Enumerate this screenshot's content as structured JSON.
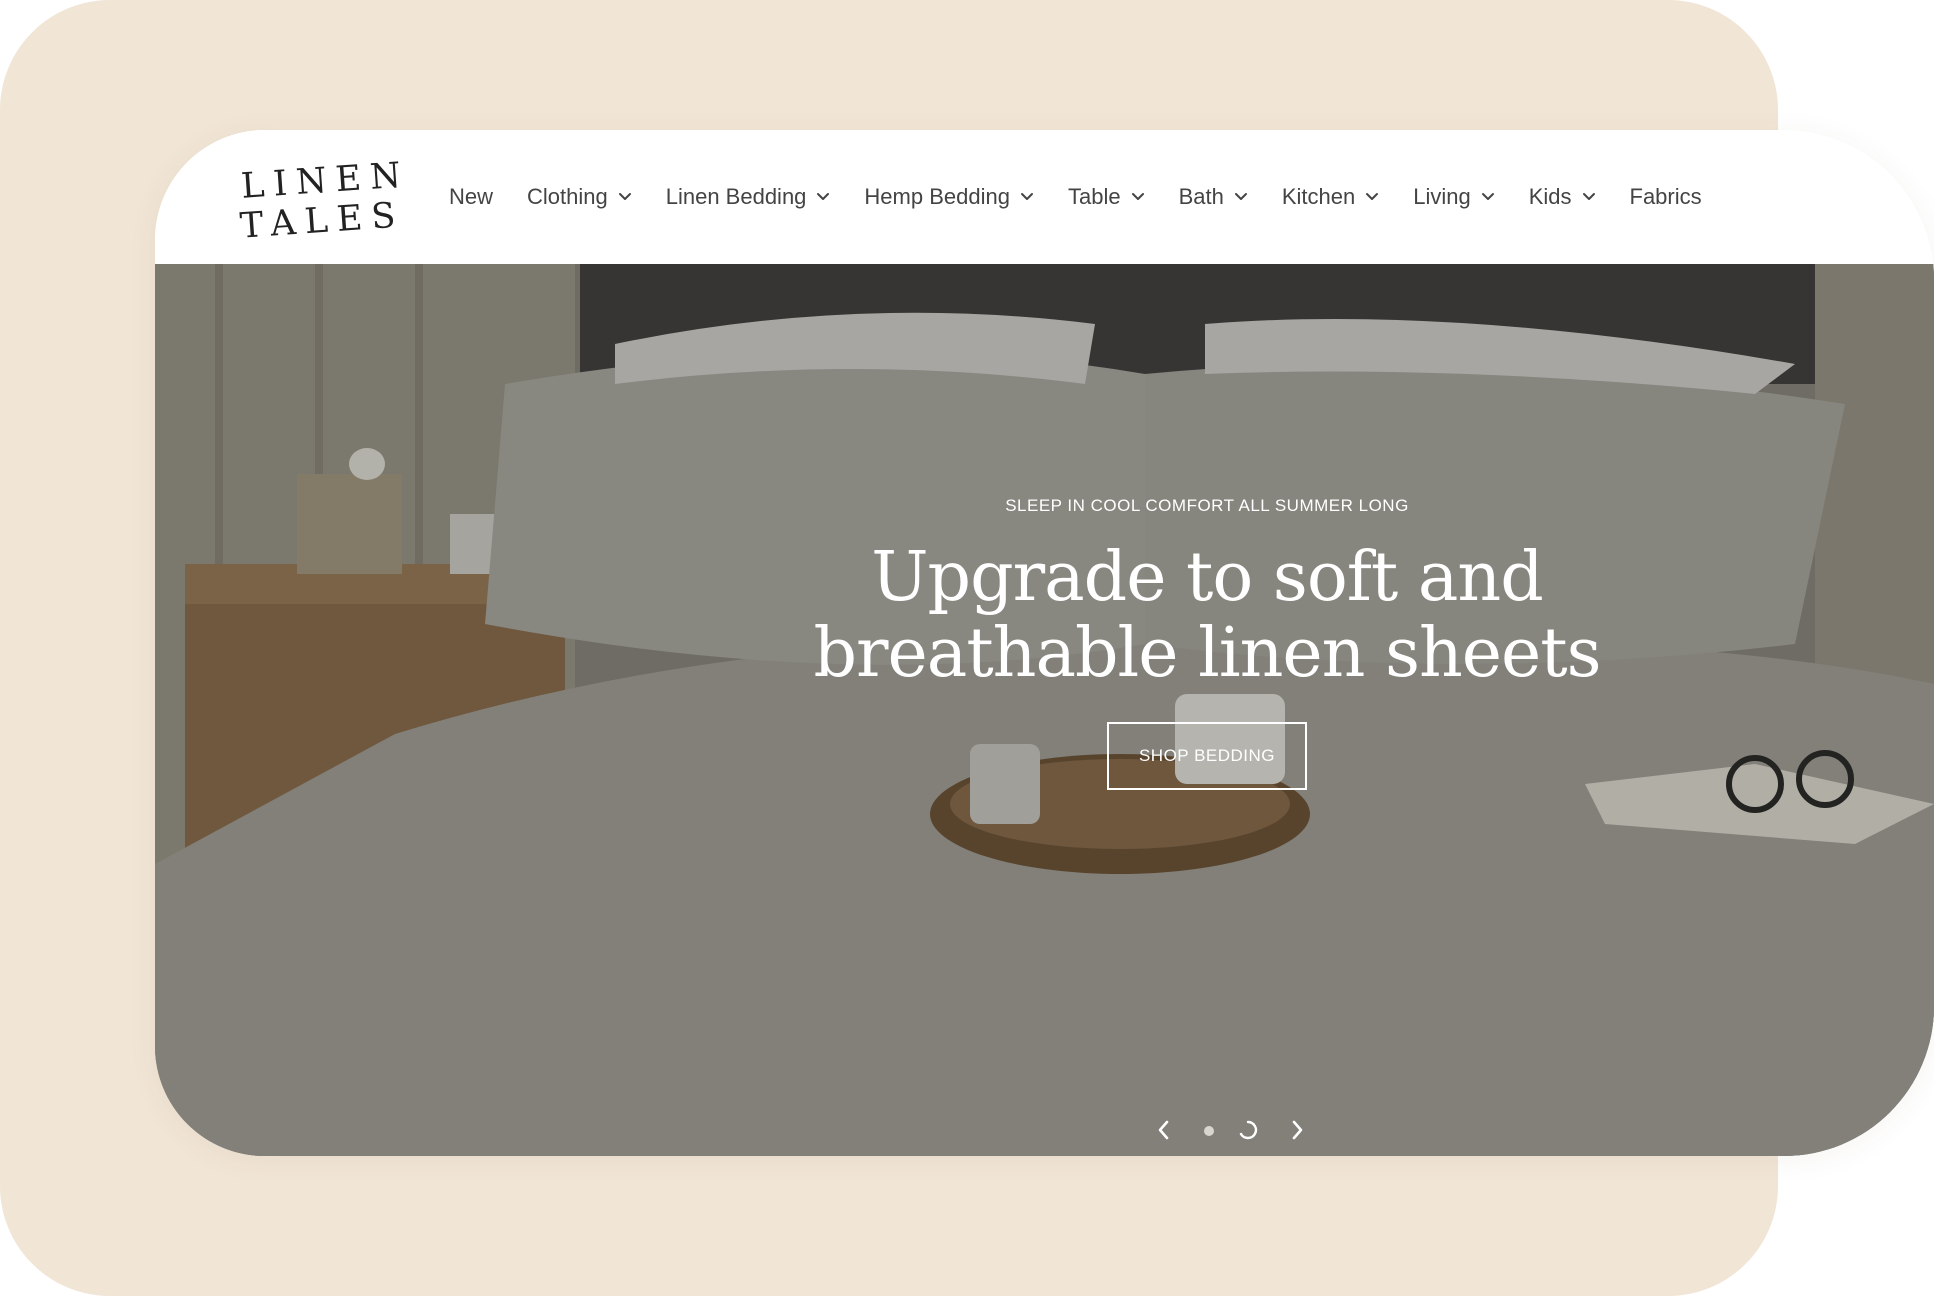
{
  "brand": {
    "logo_line1": "LINEN",
    "logo_line2": "TALES"
  },
  "nav": {
    "items": [
      {
        "label": "New",
        "has_dropdown": false
      },
      {
        "label": "Clothing",
        "has_dropdown": true
      },
      {
        "label": "Linen Bedding",
        "has_dropdown": true
      },
      {
        "label": "Hemp Bedding",
        "has_dropdown": true
      },
      {
        "label": "Table",
        "has_dropdown": true
      },
      {
        "label": "Bath",
        "has_dropdown": true
      },
      {
        "label": "Kitchen",
        "has_dropdown": true
      },
      {
        "label": "Living",
        "has_dropdown": true
      },
      {
        "label": "Kids",
        "has_dropdown": true
      },
      {
        "label": "Fabrics",
        "has_dropdown": false
      }
    ]
  },
  "hero": {
    "eyebrow": "SLEEP IN COOL COMFORT ALL SUMMER LONG",
    "headline_line1": "Upgrade to soft and",
    "headline_line2": "breathable linen sheets",
    "cta_label": "SHOP BEDDING",
    "slides_total": 2,
    "active_slide": 2
  },
  "icons": {
    "dropdown": "chevron-down-icon",
    "prev": "chevron-left-icon",
    "next": "chevron-right-icon",
    "slide_dot": "dot-icon",
    "slide_progress": "progress-ring-icon"
  },
  "colors": {
    "backdrop": "#f1e5d6",
    "text_dark": "#222222",
    "nav_text": "#444444",
    "hero_text": "#ffffff"
  }
}
